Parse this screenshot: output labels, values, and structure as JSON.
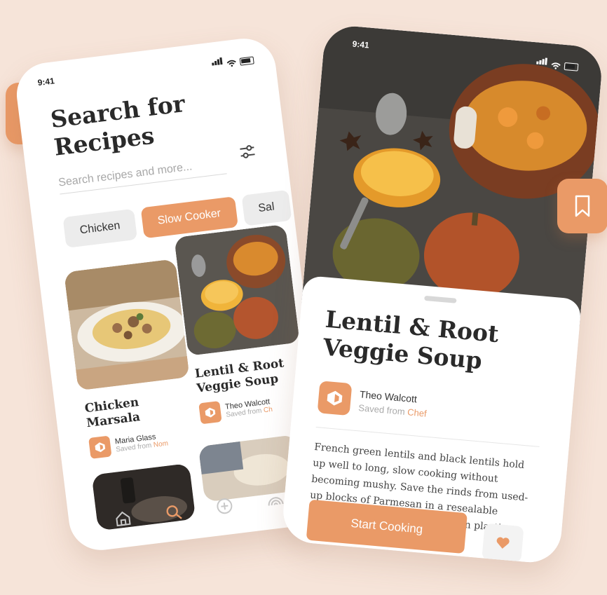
{
  "colors": {
    "accent": "#ea9a67",
    "background": "#f6e4d9",
    "text": "#2a2a2a"
  },
  "search_screen": {
    "status_time": "9:41",
    "title_line1": "Search for",
    "title_line2": "Recipes",
    "search_placeholder": "Search recipes and more...",
    "chips": [
      "Chicken",
      "Slow Cooker",
      "Sal"
    ],
    "cards": [
      {
        "title": "Chicken Marsala",
        "author": "Maria Glass",
        "saved_prefix": "Saved from",
        "saved_source": "Nom"
      },
      {
        "title": "Lentil & Root Veggie Soup",
        "author": "Theo Walcott",
        "saved_prefix": "Saved from",
        "saved_source": "Ch"
      }
    ],
    "tabbar_icons": [
      "home-icon",
      "search-icon",
      "add-icon",
      "rainbow-icon"
    ]
  },
  "detail_screen": {
    "status_time": "9:41",
    "title": "Lentil & Root Veggie Soup",
    "author": "Theo Walcott",
    "saved_prefix": "Saved from",
    "saved_source": "Chef",
    "description": "French green lentils and black lentils hold up well to long, slow cooking without becoming mushy. Save the rinds from used-up blocks of Parmesan in a resealable plastic bag or tightly wrapped in plastic wrap in the freezer. The",
    "start_button": "Start Cooking"
  }
}
